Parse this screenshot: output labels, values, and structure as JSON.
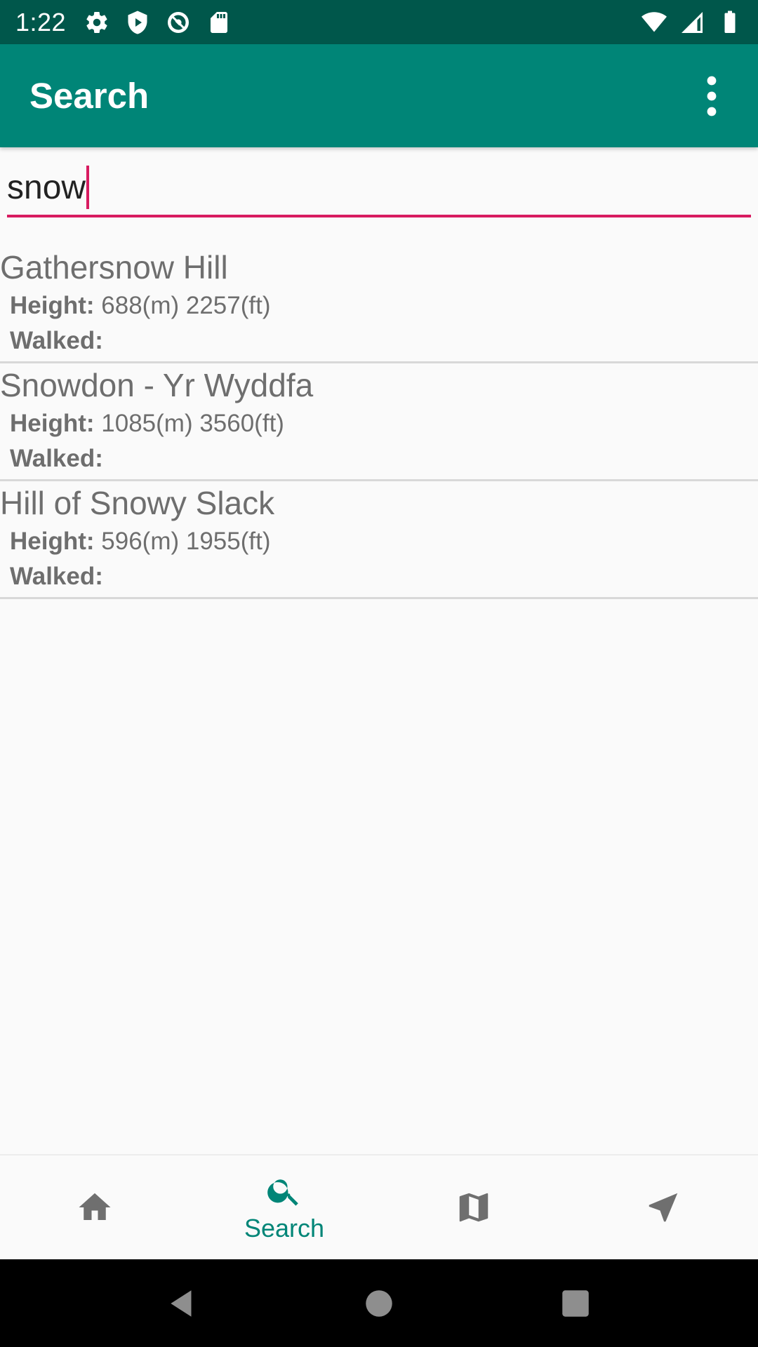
{
  "status_bar": {
    "time": "1:22",
    "left_icons": [
      "settings-icon",
      "shield-play-icon",
      "no-tracking-icon",
      "sd-card-icon"
    ],
    "right_icons": [
      "wifi-icon",
      "cell-signal-icon",
      "battery-icon"
    ],
    "background": "#00574b"
  },
  "app_bar": {
    "title": "Search",
    "background": "#008577",
    "overflow_icon": "more-vert-icon"
  },
  "search": {
    "value": "snow",
    "underline_color": "#d81b60"
  },
  "results": [
    {
      "name": "Gathersnow Hill",
      "height_label": "Height:",
      "height_value": " 688(m) 2257(ft)",
      "walked_label": "Walked:",
      "walked_value": ""
    },
    {
      "name": "Snowdon - Yr Wyddfa",
      "height_label": "Height:",
      "height_value": " 1085(m) 3560(ft)",
      "walked_label": "Walked:",
      "walked_value": ""
    },
    {
      "name": "Hill of Snowy Slack",
      "height_label": "Height:",
      "height_value": " 596(m) 1955(ft)",
      "walked_label": "Walked:",
      "walked_value": ""
    }
  ],
  "bottom_nav": {
    "items": [
      {
        "icon": "home-icon",
        "label": ""
      },
      {
        "icon": "search-icon",
        "label": "Search",
        "active": true
      },
      {
        "icon": "map-icon",
        "label": ""
      },
      {
        "icon": "navigation-icon",
        "label": ""
      }
    ],
    "active_color": "#008577"
  },
  "system_nav": [
    "back-icon",
    "home-circle-icon",
    "recents-icon"
  ]
}
